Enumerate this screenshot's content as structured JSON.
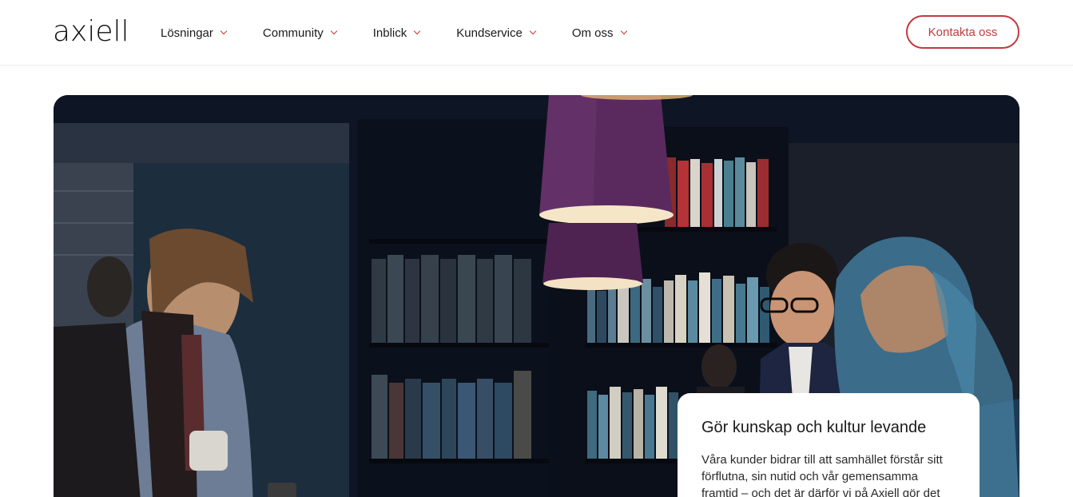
{
  "header": {
    "logo_text": "axiell",
    "nav": [
      {
        "label": "Lösningar"
      },
      {
        "label": "Community"
      },
      {
        "label": "Inblick"
      },
      {
        "label": "Kundservice"
      },
      {
        "label": "Om oss"
      }
    ],
    "contact_label": "Kontakta oss"
  },
  "hero": {
    "image_subject": "library-people-photo",
    "card": {
      "title": "Gör kunskap och kultur levande",
      "text": "Våra kunder bidrar till att samhället förstår sitt förflutna, sin nutid och vår gemensamma framtid – och det är därför vi på Axiell gör det"
    }
  },
  "colors": {
    "accent": "#c23a3c",
    "text": "#1a1a1a",
    "hero_dark": "#0d1423",
    "lamp_purple": "#5a2a5e"
  }
}
